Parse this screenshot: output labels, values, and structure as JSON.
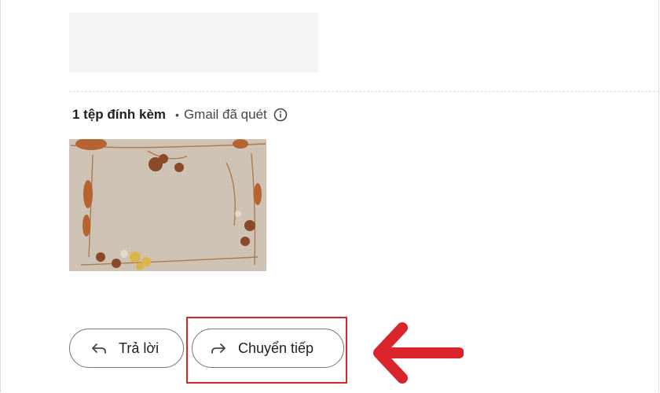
{
  "attachments": {
    "count_label": "1 tệp đính kèm",
    "separator": "•",
    "scan_label": "Gmail đã quét",
    "info_icon": "info-icon"
  },
  "actions": {
    "reply_label": "Trả lời",
    "reply_icon": "reply-arrow-icon",
    "forward_label": "Chuyển tiếp",
    "forward_icon": "forward-arrow-icon"
  },
  "annotation": {
    "highlight_color": "#d9242b",
    "pointer_icon": "left-arrow-icon"
  }
}
